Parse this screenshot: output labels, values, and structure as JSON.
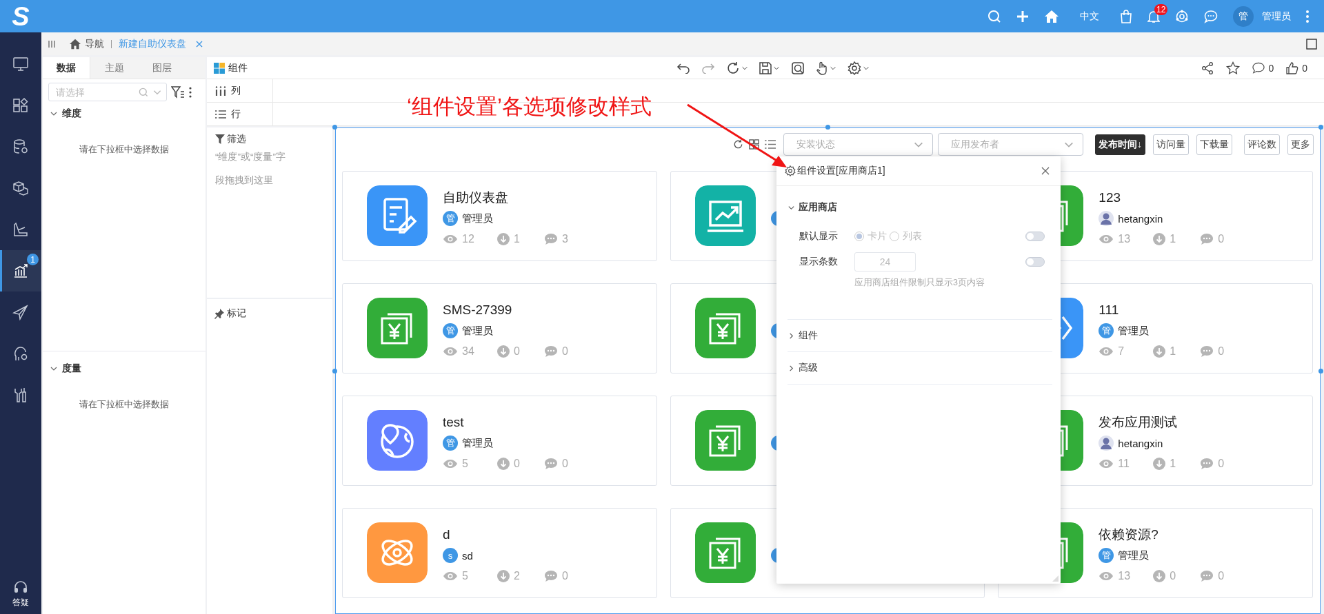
{
  "topbar": {
    "logo": "S",
    "language": "中文",
    "notifications": "12",
    "avatar": "管",
    "user": "管理员"
  },
  "nav": {
    "items": [
      {
        "selected": false
      },
      {
        "selected": false
      },
      {
        "selected": false
      },
      {
        "selected": false
      },
      {
        "selected": false
      },
      {
        "selected": true,
        "badge": "1"
      },
      {
        "selected": false
      },
      {
        "selected": false
      },
      {
        "selected": false
      }
    ],
    "help": "答疑"
  },
  "tabs": [
    {
      "label": "导航",
      "kind": "home",
      "selected": false
    },
    {
      "label": "新建自助仪表盘",
      "kind": "page",
      "selected": true
    }
  ],
  "left_panel": {
    "tabs": [
      {
        "label": "数据",
        "selected": true
      },
      {
        "label": "主题",
        "selected": false
      },
      {
        "label": "图层",
        "selected": false
      }
    ],
    "search": {
      "placeholder": "请选择"
    },
    "sections": [
      {
        "title": "维度",
        "expanded": true,
        "empty_text": "请在下拉框中选择数据"
      },
      {
        "title": "度量",
        "expanded": true,
        "empty_text": "请在下拉框中选择数据"
      }
    ]
  },
  "designer": {
    "title": "组件",
    "columns_label": "列",
    "rows_label": "行",
    "filter_title": "筛选",
    "filter_hint": "“维度”或“度量”字段拖拽到这里",
    "marks_title": "标记",
    "comments": "0",
    "likes": "0"
  },
  "annotation": "‘组件设置’各选项修改样式",
  "widget": {
    "filters": [
      {
        "placeholder": "安装状态"
      },
      {
        "placeholder": "应用发布者"
      }
    ],
    "sorts": [
      {
        "label": "发布时间↓",
        "selected": true
      },
      {
        "label": "访问量",
        "selected": false
      },
      {
        "label": "下载量",
        "selected": false
      },
      {
        "label": "评论数",
        "selected": false
      },
      {
        "label": "更多",
        "selected": false
      }
    ],
    "cards": [
      {
        "title": "自助仪表盘",
        "kind": "form",
        "color": "#3a95f7",
        "avatar": {
          "kind": "initial",
          "text": "管"
        },
        "author": "管理员",
        "views": "12",
        "downloads": "1",
        "comments": "3"
      },
      {
        "kind": "chart",
        "color": "#13b2a6",
        "avatar": {
          "kind": "initial"
        }
      },
      {
        "title": "123",
        "kind": "yuan",
        "color": "#32ad39",
        "avatar": {
          "kind": "photo"
        },
        "author": "hetangxin",
        "views": "13",
        "downloads": "1",
        "comments": "0"
      },
      {
        "title": "SMS-27399",
        "kind": "yuan",
        "color": "#32ad39",
        "avatar": {
          "kind": "initial",
          "text": "管"
        },
        "author": "管理员",
        "views": "34",
        "downloads": "0",
        "comments": "0"
      },
      {
        "kind": "yuan",
        "color": "#32ad39",
        "avatar": {
          "kind": "initial"
        }
      },
      {
        "title": "111",
        "kind": "code",
        "color": "#3a95f7",
        "avatar": {
          "kind": "initial",
          "text": "管"
        },
        "author": "管理员",
        "views": "7",
        "downloads": "1",
        "comments": "0"
      },
      {
        "title": "test",
        "kind": "globe",
        "color": "#637fff",
        "avatar": {
          "kind": "initial",
          "text": "管"
        },
        "author": "管理员",
        "views": "5",
        "downloads": "0",
        "comments": "0"
      },
      {
        "kind": "yuan",
        "color": "#32ad39",
        "avatar": {
          "kind": "initial"
        }
      },
      {
        "title": "发布应用测试",
        "kind": "yuan",
        "color": "#32ad39",
        "avatar": {
          "kind": "photo"
        },
        "author": "hetangxin",
        "views": "11",
        "downloads": "1",
        "comments": "0"
      },
      {
        "title": "d",
        "kind": "atom",
        "color": "#ff9840",
        "avatar": {
          "kind": "initial",
          "text": "s"
        },
        "author": "sd",
        "views": "5",
        "downloads": "2",
        "comments": "0"
      },
      {
        "kind": "yuan",
        "color": "#32ad39",
        "avatar": {
          "kind": "initial"
        }
      },
      {
        "title": "依赖资源?",
        "kind": "yuan",
        "color": "#32ad39",
        "avatar": {
          "kind": "initial",
          "text": "管"
        },
        "author": "管理员",
        "views": "13",
        "downloads": "0",
        "comments": "0"
      }
    ]
  },
  "settings": {
    "title": "组件设置[应用商店1]",
    "sections": [
      {
        "title": "应用商店",
        "expanded": true,
        "fields": [
          {
            "kind": "radio",
            "label": "默认显示",
            "disabled": true,
            "toggle_on": false,
            "options": [
              {
                "label": "卡片",
                "selected": true
              },
              {
                "label": "列表",
                "selected": false
              }
            ]
          },
          {
            "kind": "number",
            "label": "显示条数",
            "disabled": true,
            "toggle_on": false,
            "value": "24"
          }
        ],
        "note": "应用商店组件限制只显示3页内容"
      },
      {
        "title": "组件",
        "expanded": false
      },
      {
        "title": "高级",
        "expanded": false
      }
    ]
  }
}
